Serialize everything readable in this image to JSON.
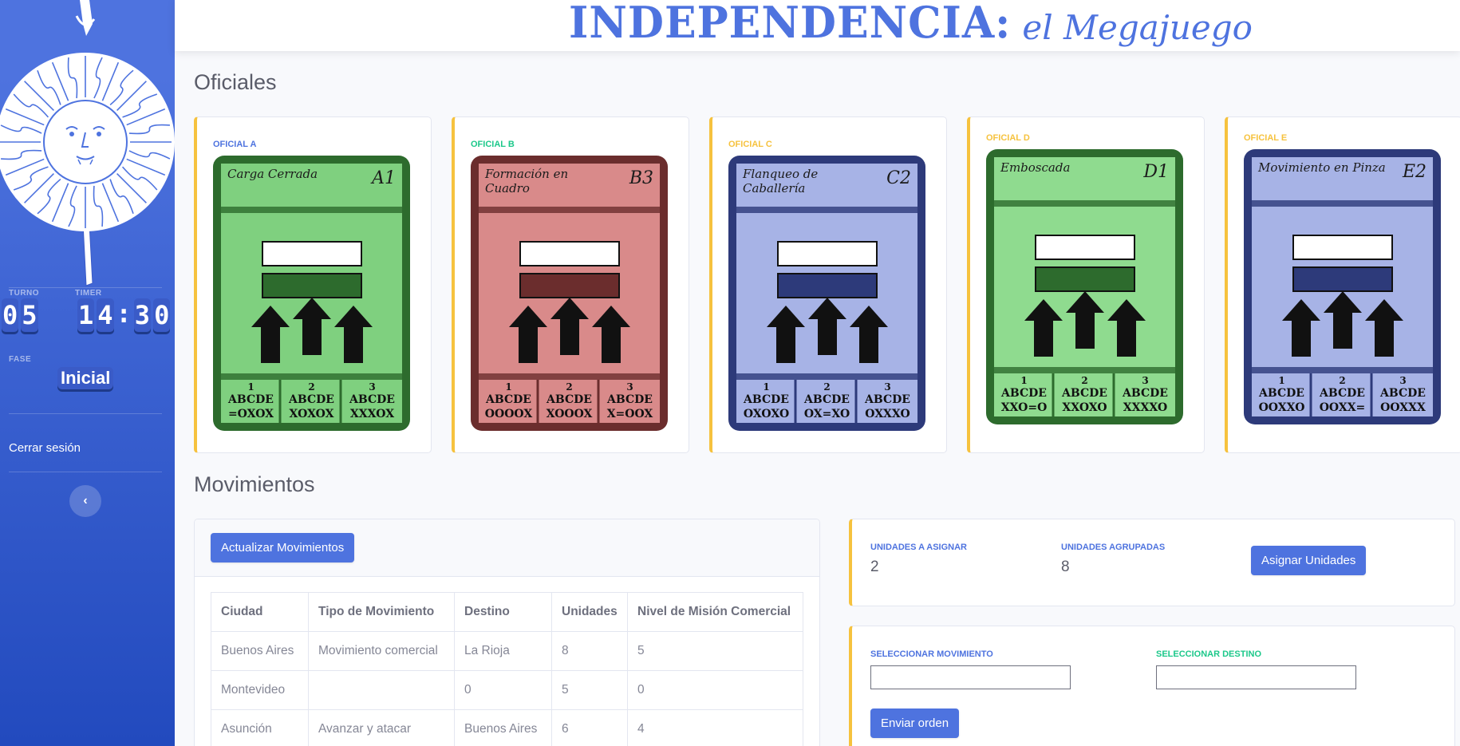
{
  "brand": {
    "title": "INDEPENDENCIA:",
    "subtitle": "el Megajuego"
  },
  "sidebar": {
    "turno_label": "TURNO",
    "turno_digits": [
      "0",
      "5"
    ],
    "timer_label": "TIMER",
    "timer_digits": [
      "1",
      "4",
      "3",
      "0"
    ],
    "timer_separator": ":",
    "fase_label": "FASE",
    "fase_value": "Inicial",
    "logout_label": "Cerrar sesión",
    "toggle_icon": "chevron-left-icon"
  },
  "sections": {
    "oficiales": "Oficiales",
    "movimientos": "Movimientos"
  },
  "oficiales": [
    {
      "label": "OFICIAL A",
      "label_color": "#4e73df",
      "card_title": "Carga Cerrada",
      "card_code": "A1",
      "theme": "#7fd07f",
      "frame": "#2d6b2d",
      "cols": [
        {
          "n": "1",
          "a": "ABCDE",
          "b": "=OXOX"
        },
        {
          "n": "2",
          "a": "ABCDE",
          "b": "XOXOX"
        },
        {
          "n": "3",
          "a": "ABCDE",
          "b": "XXXOX"
        }
      ]
    },
    {
      "label": "OFICIAL B",
      "label_color": "#1cc88a",
      "card_title": "Formación en Cuadro",
      "card_code": "B3",
      "theme": "#d98a8a",
      "frame": "#6b2d2d",
      "cols": [
        {
          "n": "1",
          "a": "ABCDE",
          "b": "OOOOX"
        },
        {
          "n": "2",
          "a": "ABCDE",
          "b": "XOOOX"
        },
        {
          "n": "3",
          "a": "ABCDE",
          "b": "X=OOX"
        }
      ]
    },
    {
      "label": "OFICIAL C",
      "label_color": "#f6c23e",
      "card_title": "Flanqueo de Caballería",
      "card_code": "C2",
      "theme": "#a7b3e6",
      "frame": "#2d3a7a",
      "cols": [
        {
          "n": "1",
          "a": "ABCDE",
          "b": "OXOXO"
        },
        {
          "n": "2",
          "a": "ABCDE",
          "b": "OX=XO"
        },
        {
          "n": "3",
          "a": "ABCDE",
          "b": "OXXXO"
        }
      ]
    },
    {
      "label": "OFICIAL D",
      "label_color": "#f6c23e",
      "card_title": "Emboscada",
      "card_code": "D1",
      "theme": "#8fdb8f",
      "frame": "#2d6b2d",
      "cols": [
        {
          "n": "1",
          "a": "ABCDE",
          "b": "XXO=O"
        },
        {
          "n": "2",
          "a": "ABCDE",
          "b": "XXOXO"
        },
        {
          "n": "3",
          "a": "ABCDE",
          "b": "XXXXO"
        }
      ]
    },
    {
      "label": "OFICIAL E",
      "label_color": "#f6c23e",
      "card_title": "Movimiento en Pinza",
      "card_code": "E2",
      "theme": "#a7b3e6",
      "frame": "#2d3a7a",
      "cols": [
        {
          "n": "1",
          "a": "ABCDE",
          "b": "OOXXO"
        },
        {
          "n": "2",
          "a": "ABCDE",
          "b": "OOXX="
        },
        {
          "n": "3",
          "a": "ABCDE",
          "b": "OOXXX"
        }
      ]
    }
  ],
  "movimientos": {
    "update_button": "Actualizar Movimientos",
    "headers": [
      "Ciudad",
      "Tipo de Movimiento",
      "Destino",
      "Unidades",
      "Nivel de Misión Comercial"
    ],
    "rows": [
      [
        "Buenos Aires",
        "Movimiento comercial",
        "La Rioja",
        "8",
        "5"
      ],
      [
        "Montevideo",
        "",
        "0",
        "5",
        "0"
      ],
      [
        "Asunción",
        "Avanzar y atacar",
        "Buenos Aires",
        "6",
        "4"
      ]
    ]
  },
  "asignar": {
    "unidades_label": "UNIDADES A ASIGNAR",
    "unidades_value": "2",
    "agrupadas_label": "UNIDADES AGRUPADAS",
    "agrupadas_value": "8",
    "button": "Asignar Unidades"
  },
  "orden": {
    "mov_label": "SELECCIONAR MOVIMIENTO",
    "mov_value": "",
    "dest_label": "SELECCIONAR DESTINO",
    "dest_value": "",
    "button": "Enviar orden"
  },
  "colors": {
    "primary": "#4e73df",
    "warning": "#f6c23e",
    "success": "#1cc88a"
  }
}
